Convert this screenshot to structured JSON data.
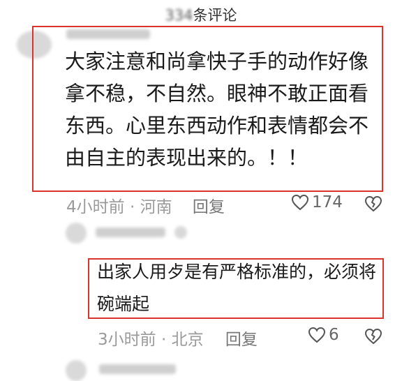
{
  "header": {
    "count_prefix": "334",
    "count_suffix": "条评论"
  },
  "comment1": {
    "text": "大家注意和尚拿快子手的动作好像拿不稳，不自然。眼神不敢正面看东西。心里东西动作和表情都会不由自主的表现出来的。！！",
    "time": "4小时前",
    "location": "河南",
    "reply": "回复",
    "likes": "174"
  },
  "comment2": {
    "text": "出家人用歺是有严格标准的，必须将碗端起",
    "time": "3小时前",
    "location": "北京",
    "reply": "回复",
    "likes": "6"
  },
  "icons": {
    "like": "heart-icon",
    "dislike": "broken-heart-icon"
  },
  "colors": {
    "highlight": "#d9342b",
    "meta": "#9a9a9a"
  }
}
